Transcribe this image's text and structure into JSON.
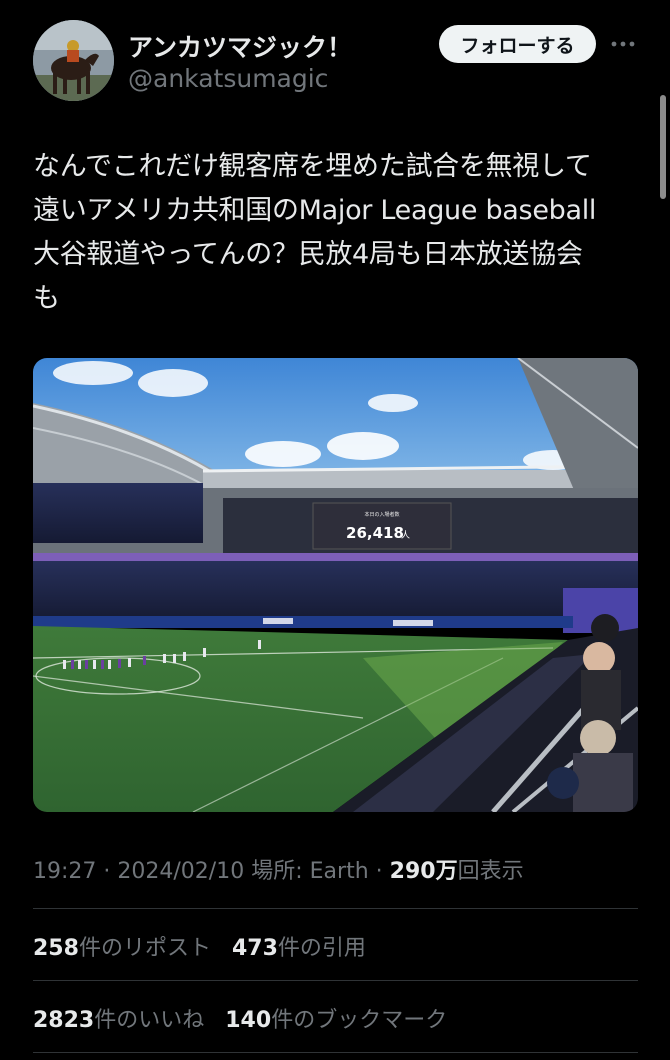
{
  "author": {
    "display_name": "アンカツマジック！",
    "handle": "@ankatsumagic",
    "follow_label": "フォローする"
  },
  "icons": {
    "more": "more-horizontal-icon",
    "avatar": "avatar-horse-racing"
  },
  "tweet": {
    "text": "なんでこれだけ観客席を埋めた試合を無視して\n遠いアメリカ共和国のMajor League baseball\n大谷報道やってんの？民放4局も日本放送協会\nも",
    "photo": {
      "scoreboard_label": "本日の入場者数",
      "scoreboard_value": "26,418",
      "scoreboard_unit": "人"
    }
  },
  "meta": {
    "time": "19:27",
    "date": "2024/02/10",
    "location_label": "場所:",
    "location": "Earth",
    "views_value": "290万",
    "views_label": "回表示",
    "sep": "·"
  },
  "stats": {
    "reposts_value": "258",
    "reposts_label": "件のリポスト",
    "quotes_value": "473",
    "quotes_label": "件の引用",
    "likes_value": "2823",
    "likes_label": "件のいいね",
    "bookmarks_value": "140",
    "bookmarks_label": "件のブックマーク"
  },
  "colors": {
    "background": "#000000",
    "text_primary": "#e7e9ea",
    "text_secondary": "#71767b",
    "follow_bg": "#eff3f4",
    "divider": "#2f3336"
  }
}
